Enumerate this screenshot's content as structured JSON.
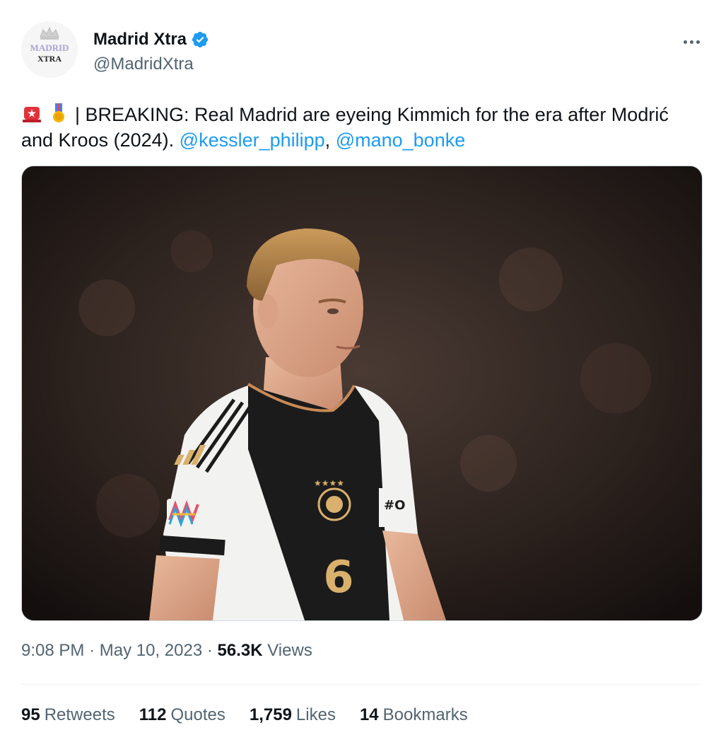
{
  "author": {
    "display_name": "Madrid Xtra",
    "handle": "@MadridXtra",
    "avatar_text_top": "MADRID",
    "avatar_text_bottom": "XTRA",
    "verified_color": "#1d9bf0"
  },
  "tweet": {
    "emoji_1": "police-light-icon",
    "emoji_2": "medal-icon",
    "text_main": "| BREAKING: Real Madrid are eyeing Kimmich for the era after Modrić and Kroos (2024).",
    "mention_1": "@kessler_philipp",
    "separator": ",",
    "mention_2": "@mano_bonke"
  },
  "media": {
    "jersey_number": "6",
    "sleeve_text": "#O"
  },
  "meta": {
    "time": "9:08 PM",
    "dot_1": "·",
    "date": "May 10, 2023",
    "dot_2": "·",
    "views_count": "56.3K",
    "views_label": "Views"
  },
  "stats": [
    {
      "count": "95",
      "label": "Retweets"
    },
    {
      "count": "112",
      "label": "Quotes"
    },
    {
      "count": "1,759",
      "label": "Likes"
    },
    {
      "count": "14",
      "label": "Bookmarks"
    }
  ],
  "colors": {
    "link": "#1d9bf0",
    "secondary_text": "#536471",
    "primary_text": "#0f1419"
  }
}
